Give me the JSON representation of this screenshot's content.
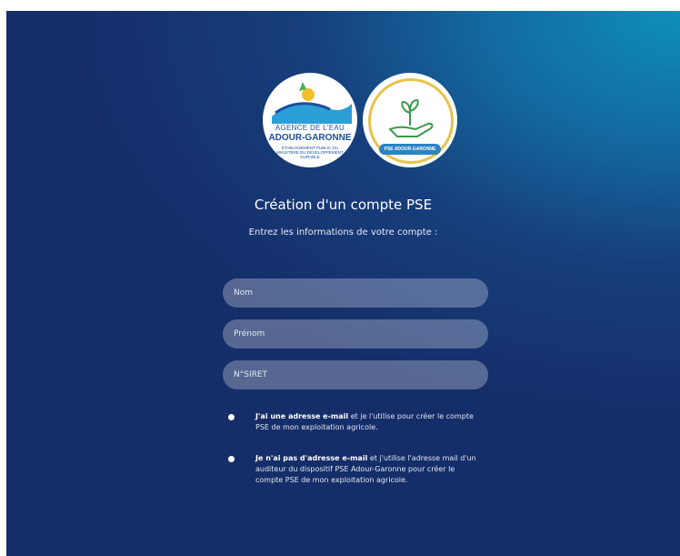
{
  "logos": {
    "agence": {
      "line1": "AGENCE DE L'EAU",
      "line2": "ADOUR-GARONNE",
      "line3": "Établissement public du ministère du développement durable"
    },
    "pse": {
      "banner": "PSE ADOUR-GARONNE",
      "icon": "hand-plant-icon"
    }
  },
  "title": "Création d'un compte PSE",
  "subtitle": "Entrez les informations de votre compte :",
  "form": {
    "nom_placeholder": "Nom",
    "prenom_placeholder": "Prénom",
    "siret_placeholder": "N°SIRET"
  },
  "options": [
    {
      "bold": "J'ai une adresse e-mail",
      "rest": " et je l'utilise pour créer le compte PSE de mon exploitation agricole."
    },
    {
      "bold": "Je n'ai pas d'adresse e-mail",
      "rest": " et j'utilise l'adresse mail d'un auditeur du dispositif PSE Adour-Garonne pour créer le compte PSE de mon exploitation agricole."
    }
  ],
  "colors": {
    "panel_dark": "#152e69",
    "panel_light": "#0e8fb8",
    "logo_blue": "#1c4f9c",
    "logo_gold": "#e8c34a"
  }
}
